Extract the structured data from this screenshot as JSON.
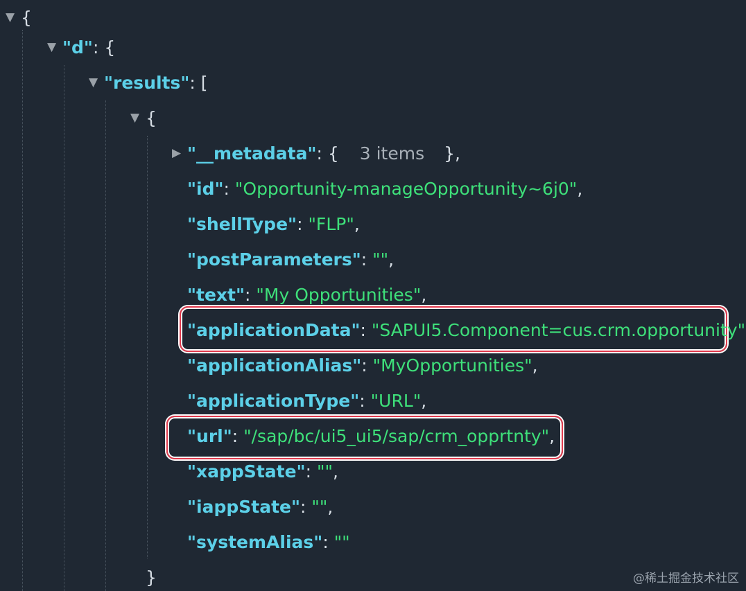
{
  "tree": {
    "root_open": "{",
    "d": {
      "key": "\"d\"",
      "sep": ": ",
      "open": "{"
    },
    "results": {
      "key": "\"results\"",
      "sep": ": ",
      "open": "["
    },
    "item_open": "{",
    "metadata": {
      "key": "\"__metadata\"",
      "sep": ": ",
      "open": "{",
      "count": "3 items",
      "close": "},"
    },
    "fields": [
      {
        "key": "\"id\"",
        "sep": ": ",
        "value": "\"Opportunity-manageOpportunity~6j0\"",
        "end": ","
      },
      {
        "key": "\"shellType\"",
        "sep": ": ",
        "value": "\"FLP\"",
        "end": ","
      },
      {
        "key": "\"postParameters\"",
        "sep": ": ",
        "value": "\"\"",
        "end": ","
      },
      {
        "key": "\"text\"",
        "sep": ": ",
        "value": "\"My Opportunities\"",
        "end": ","
      },
      {
        "key": "\"applicationData\"",
        "sep": ": ",
        "value": "\"SAPUI5.Component=cus.crm.opportunity\"",
        "end": ","
      },
      {
        "key": "\"applicationAlias\"",
        "sep": ": ",
        "value": "\"MyOpportunities\"",
        "end": ","
      },
      {
        "key": "\"applicationType\"",
        "sep": ": ",
        "value": "\"URL\"",
        "end": ","
      },
      {
        "key": "\"url\"",
        "sep": ": ",
        "value": "\"/sap/bc/ui5_ui5/sap/crm_opprtnty\"",
        "end": ","
      },
      {
        "key": "\"xappState\"",
        "sep": ": ",
        "value": "\"\"",
        "end": ","
      },
      {
        "key": "\"iappState\"",
        "sep": ": ",
        "value": "\"\"",
        "end": ","
      },
      {
        "key": "\"systemAlias\"",
        "sep": ": ",
        "value": "\"\"",
        "end": ""
      }
    ],
    "item_close": "}"
  },
  "icons": {
    "expanded": "▼",
    "collapsed": "▶"
  },
  "colors": {
    "background": "#1f2833",
    "key": "#5cd0e8",
    "string": "#3ee07a",
    "punctuation": "#d6dde4",
    "highlight": "#e03a4d"
  },
  "watermark": "@稀土掘金技术社区"
}
